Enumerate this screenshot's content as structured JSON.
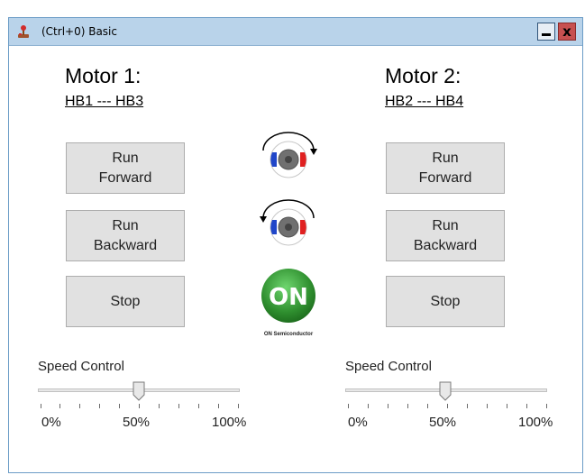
{
  "window": {
    "title": "(Ctrl+0) Basic",
    "close_glyph": "x",
    "border_color": "#6b9cc6",
    "titlebar_color": "#b9d3ea"
  },
  "motor1": {
    "title": "Motor 1:",
    "subtitle": "HB1 --- HB3",
    "run_forward": "Run\nForward",
    "run_backward": "Run\nBackward",
    "stop": "Stop",
    "speed_label": "Speed Control",
    "speed_percent": 50,
    "ticks": [
      "0%",
      "50%",
      "100%"
    ]
  },
  "motor2": {
    "title": "Motor 2:",
    "subtitle": "HB2 --- HB4",
    "run_forward": "Run\nForward",
    "run_backward": "Run\nBackward",
    "stop": "Stop",
    "speed_label": "Speed Control",
    "speed_percent": 50,
    "ticks": [
      "0%",
      "50%",
      "100%"
    ]
  },
  "center": {
    "forward_icon": "motor-rotate-clockwise-icon",
    "backward_icon": "motor-rotate-counterclockwise-icon",
    "logo_text": "ON",
    "logo_caption": "ON Semiconductor",
    "logo_color": "#3a9b3a"
  }
}
